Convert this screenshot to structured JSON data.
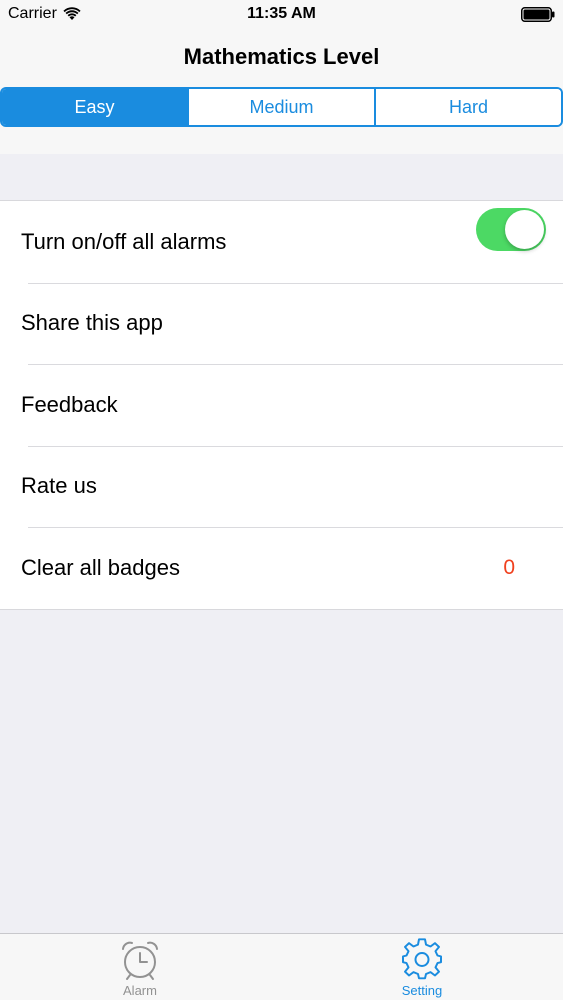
{
  "status_bar": {
    "carrier": "Carrier",
    "time": "11:35 AM"
  },
  "nav": {
    "title": "Mathematics Level",
    "segments": [
      {
        "label": "Easy",
        "selected": true
      },
      {
        "label": "Medium",
        "selected": false
      },
      {
        "label": "Hard",
        "selected": false
      }
    ]
  },
  "settings": {
    "items": [
      {
        "label": "Turn on/off all alarms",
        "toggle_on": true
      },
      {
        "label": "Share this app"
      },
      {
        "label": "Feedback"
      },
      {
        "label": "Rate us"
      },
      {
        "label": "Clear all badges",
        "value": "0"
      }
    ]
  },
  "tab_bar": {
    "tabs": [
      {
        "label": "Alarm",
        "icon": "alarm-clock-icon",
        "selected": false
      },
      {
        "label": "Setting",
        "icon": "gear-icon",
        "selected": true
      }
    ]
  },
  "colors": {
    "accent": "#1a8cdf",
    "toggle_on": "#4cd964",
    "badge_value": "#f0411f",
    "inactive_tab": "#929292",
    "background": "#efeff4"
  }
}
